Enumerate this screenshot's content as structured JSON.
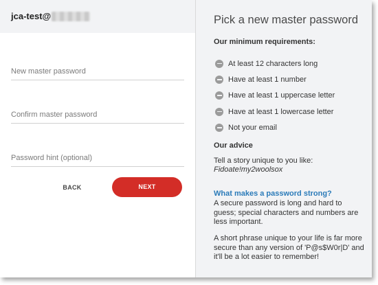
{
  "account": {
    "email_visible": "jca-test@"
  },
  "form": {
    "new_password_placeholder": "New master password",
    "confirm_password_placeholder": "Confirm master password",
    "hint_placeholder": "Password hint (optional)",
    "back_label": "BACK",
    "next_label": "NEXT"
  },
  "info": {
    "title": "Pick a new master password",
    "requirements_heading": "Our minimum requirements:",
    "requirements": [
      "At least 12 characters long",
      "Have at least 1 number",
      "Have at least 1 uppercase letter",
      "Have at least 1 lowercase letter",
      "Not your email"
    ],
    "advice_heading": "Our advice",
    "advice_text": "Tell a story unique to you like:",
    "advice_example": "Fidoate!my2woolsox",
    "strong_link": "What makes a password strong?",
    "strong_para": "A secure password is long and hard to guess; special characters and numbers are less important.",
    "phrase_para": "A short phrase unique to your life is far more secure than any version of 'P@s$W0r|D' and it'll be a lot easier to remember!"
  },
  "colors": {
    "next_button": "#d32d27",
    "link": "#2b7bb9",
    "side_panel_bg": "#f2f3f5"
  },
  "icons": {
    "requirement": "minus-circle-icon"
  }
}
